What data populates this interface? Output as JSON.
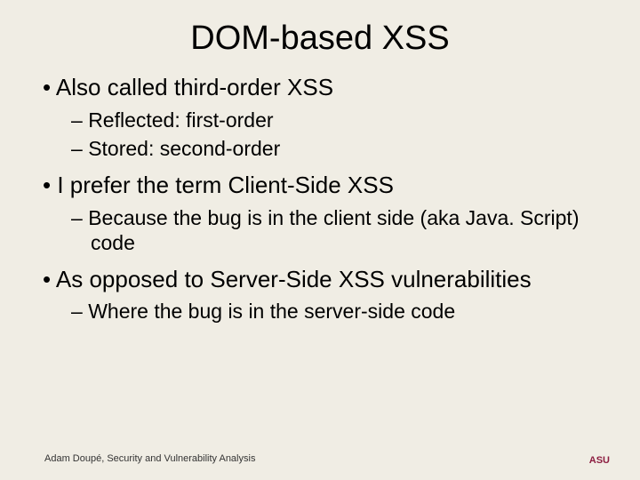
{
  "title": "DOM-based XSS",
  "bullets": {
    "b1": "Also called third-order XSS",
    "b1a": "Reflected: first-order",
    "b1b": "Stored: second-order",
    "b2": "I prefer the term Client-Side XSS",
    "b2a": "Because the bug is in the client side (aka Java. Script) code",
    "b3": "As opposed to Server-Side XSS vulnerabilities",
    "b3a": "Where the bug is in the server-side code"
  },
  "footer": "Adam Doupé, Security and Vulnerability Analysis",
  "logo": {
    "line1": "ASU"
  }
}
